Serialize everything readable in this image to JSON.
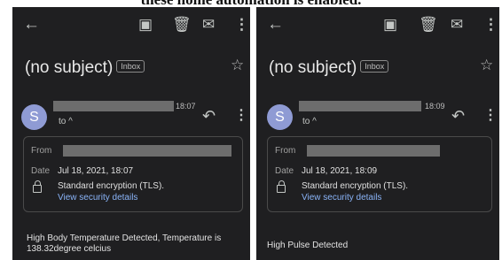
{
  "caption": "these home automation is enabled.",
  "panels": [
    {
      "subject": "(no subject)",
      "label": "Inbox",
      "time": "18:07",
      "to": "to ^",
      "from_label": "From",
      "date_label": "Date",
      "date": "Jul 18, 2021, 18:07",
      "avatar": "S",
      "encryption": "Standard encryption (TLS).",
      "security_link": "View security details",
      "body": "High Body Temperature Detected, Temperature is 138.32degree celcius"
    },
    {
      "subject": "(no subject)",
      "label": "Inbox",
      "time": "18:09",
      "to": "to ^",
      "from_label": "From",
      "date_label": "Date",
      "date": "Jul 18, 2021, 18:09",
      "avatar": "S",
      "encryption": "Standard encryption (TLS).",
      "security_link": "View security details",
      "body": "High Pulse Detected"
    }
  ],
  "icons": [
    "back-arrow-icon",
    "archive-icon",
    "delete-icon",
    "mail-icon",
    "more-vert-icon",
    "star-icon",
    "reply-icon",
    "lock-icon"
  ]
}
